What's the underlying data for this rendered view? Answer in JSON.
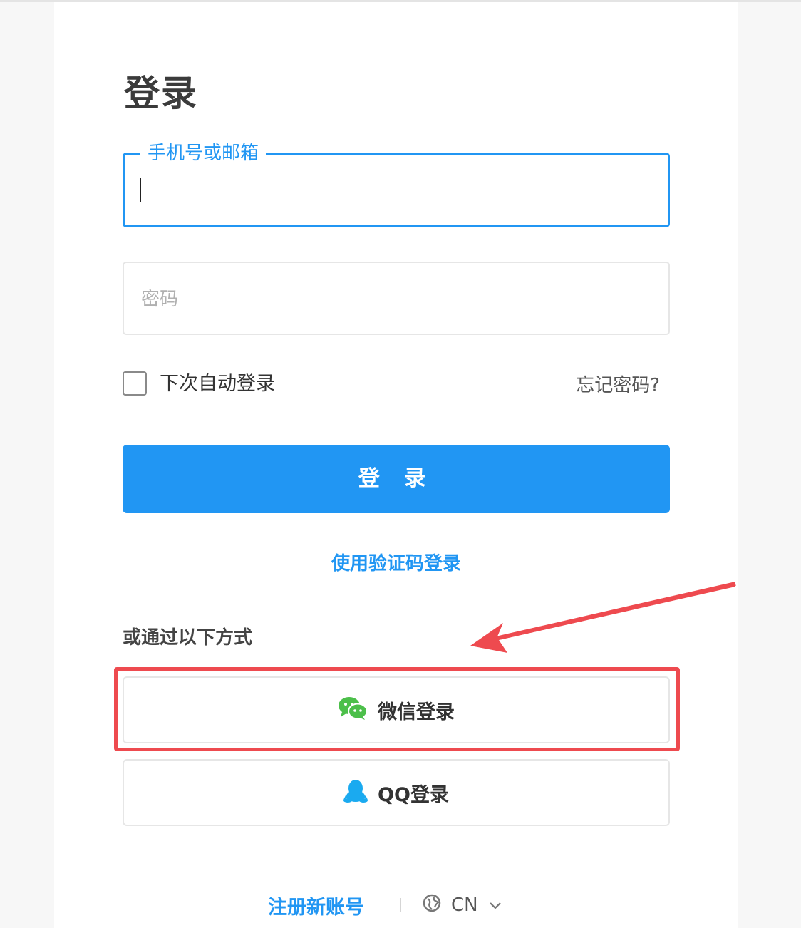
{
  "login": {
    "title": "登录",
    "phone_field": {
      "label": "手机号或邮箱",
      "value": ""
    },
    "password_field": {
      "placeholder": "密码"
    },
    "remember_me": {
      "label": "下次自动登录",
      "checked": false
    },
    "forgot_password": "忘记密码?",
    "submit_label": "登 录",
    "code_login_link": "使用验证码登录",
    "alt_methods_label": "或通过以下方式",
    "wechat_label": "微信登录",
    "qq_label": "QQ登录"
  },
  "footer": {
    "register_link": "注册新账号",
    "language": "CN"
  },
  "colors": {
    "accent": "#2196f3",
    "annotation": "#ee4a4f",
    "wechat": "#4cbf4a",
    "qq": "#1aaaf0"
  },
  "icons": [
    "wechat-icon",
    "qq-icon",
    "globe-icon",
    "chevron-down-icon",
    "annotation-arrow"
  ]
}
